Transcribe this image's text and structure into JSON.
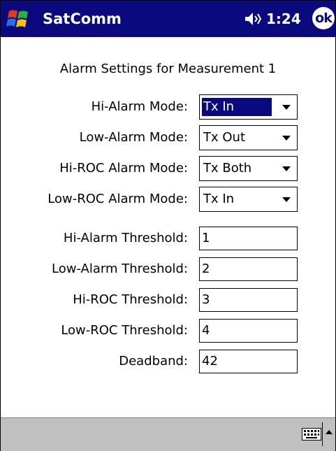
{
  "titlebar": {
    "app_title": "SatComm",
    "time": "1:24",
    "ok_label": "ok",
    "start_icon": "windows-flag-icon",
    "volume_icon": "speaker-icon"
  },
  "page_title": "Alarm Settings for Measurement 1",
  "dropdowns": [
    {
      "label": "Hi-Alarm Mode:",
      "value": "Tx In",
      "focused": true
    },
    {
      "label": "Low-Alarm Mode:",
      "value": "Tx Out",
      "focused": false
    },
    {
      "label": "Hi-ROC Alarm Mode:",
      "value": "Tx Both",
      "focused": false
    },
    {
      "label": "Low-ROC Alarm Mode:",
      "value": "Tx In",
      "focused": false
    }
  ],
  "fields": [
    {
      "label": "Hi-Alarm Threshold:",
      "value": "1"
    },
    {
      "label": "Low-Alarm Threshold:",
      "value": "2"
    },
    {
      "label": "Hi-ROC Threshold:",
      "value": "3"
    },
    {
      "label": "Low-ROC Threshold:",
      "value": "4"
    },
    {
      "label": "Deadband:",
      "value": "42"
    }
  ],
  "menubar": {
    "keyboard_icon": "keyboard-icon",
    "sip_icon": "input-panel-arrow-icon"
  },
  "colors": {
    "titlebar": "#0a0a7e",
    "selection": "#0a0a7e",
    "menubar": "#c0c0c0"
  }
}
